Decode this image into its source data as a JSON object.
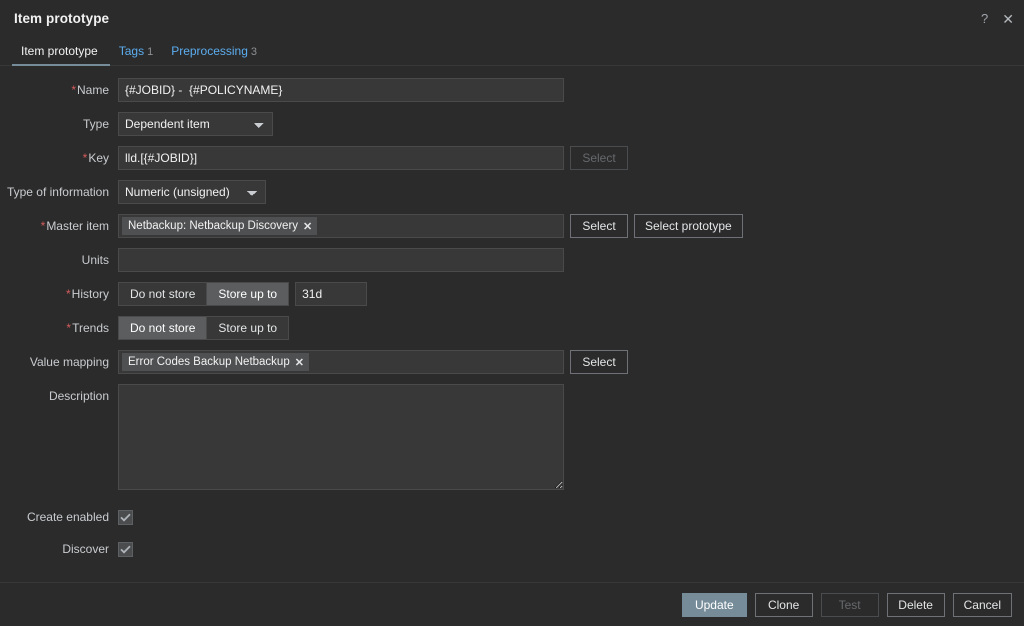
{
  "header": {
    "title": "Item prototype",
    "help_label": "?",
    "close_label": "✕"
  },
  "tabs": [
    {
      "label": "Item prototype",
      "count": "",
      "active": true
    },
    {
      "label": "Tags",
      "count": "1",
      "active": false
    },
    {
      "label": "Preprocessing",
      "count": "3",
      "active": false
    }
  ],
  "form": {
    "name": {
      "label": "Name",
      "required": true,
      "value": "{#JOBID} -  {#POLICYNAME}",
      "placeholder": ""
    },
    "type": {
      "label": "Type",
      "required": false,
      "value": "Dependent item",
      "options": [
        "Dependent item"
      ]
    },
    "key": {
      "label": "Key",
      "required": true,
      "value": "lld.[{#JOBID}]",
      "placeholder": "",
      "select_label": "Select",
      "select_disabled": true
    },
    "type_of_information": {
      "label": "Type of information",
      "required": false,
      "value": "Numeric (unsigned)",
      "options": [
        "Numeric (unsigned)"
      ]
    },
    "master_item": {
      "label": "Master item",
      "required": true,
      "chip": "Netbackup: Netbackup Discovery",
      "chip_remove": "✕",
      "select_label": "Select",
      "select_prototype_label": "Select prototype"
    },
    "units": {
      "label": "Units",
      "required": false,
      "value": "",
      "placeholder": ""
    },
    "history": {
      "label": "History",
      "required": true,
      "options": [
        "Do not store",
        "Store up to"
      ],
      "selected": "Store up to",
      "value": "31d",
      "placeholder": ""
    },
    "trends": {
      "label": "Trends",
      "required": true,
      "options": [
        "Do not store",
        "Store up to"
      ],
      "selected": "Do not store"
    },
    "value_mapping": {
      "label": "Value mapping",
      "required": false,
      "chip": "Error Codes Backup Netbackup",
      "chip_remove": "✕",
      "select_label": "Select"
    },
    "description": {
      "label": "Description",
      "required": false,
      "value": "",
      "placeholder": ""
    },
    "create_enabled": {
      "label": "Create enabled",
      "checked": true
    },
    "discover": {
      "label": "Discover",
      "checked": true
    }
  },
  "footer": {
    "update_label": "Update",
    "clone_label": "Clone",
    "test_label": "Test",
    "test_disabled": true,
    "delete_label": "Delete",
    "cancel_label": "Cancel"
  },
  "colors": {
    "background": "#2b2b2b",
    "field_background": "#383838",
    "field_border": "#4a4a4a",
    "accent": "#768d99",
    "link": "#5badf0",
    "required_asterisk": "#d45c5c",
    "text": "#f2f2f2",
    "muted_text": "#8d9094"
  }
}
